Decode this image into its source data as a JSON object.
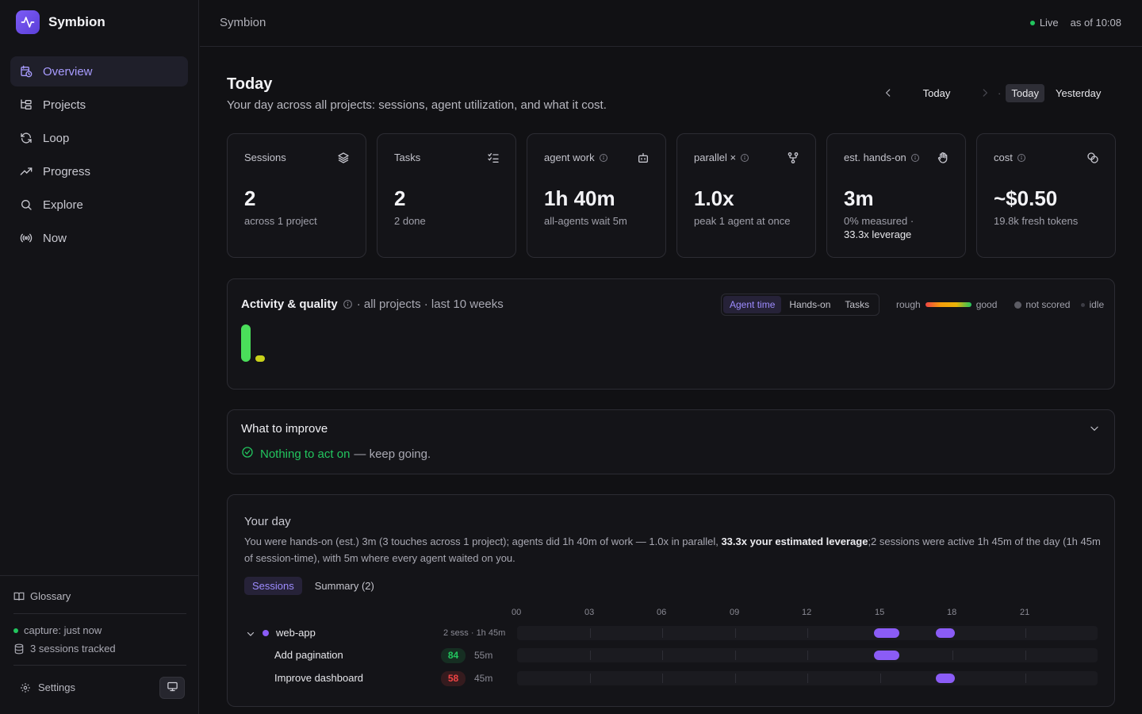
{
  "brand": {
    "name": "Symbion"
  },
  "sidebar": {
    "items": [
      {
        "label": "Overview",
        "icon": "calendar-clock-icon",
        "active": true
      },
      {
        "label": "Projects",
        "icon": "folder-tree-icon"
      },
      {
        "label": "Loop",
        "icon": "refresh-icon"
      },
      {
        "label": "Progress",
        "icon": "trend-up-icon"
      },
      {
        "label": "Explore",
        "icon": "search-icon"
      },
      {
        "label": "Now",
        "icon": "radio-broadcast-icon"
      }
    ],
    "glossary": "Glossary",
    "capture": "capture: just now",
    "tracked": "3 sessions tracked",
    "settings": "Settings"
  },
  "topbar": {
    "crumb": "Symbion",
    "live": "Live",
    "as_of": "as of 10:08"
  },
  "page": {
    "title": "Today",
    "subtitle": "Your day across all projects: sessions, agent utilization, and what it cost.",
    "date_current": "Today",
    "range_today": "Today",
    "range_yesterday": "Yesterday"
  },
  "stats": [
    {
      "label": "Sessions",
      "value": "2",
      "note": "across 1 project",
      "icon": "layers-icon"
    },
    {
      "label": "Tasks",
      "value": "2",
      "note": "2 done",
      "icon": "list-checks-icon"
    },
    {
      "label": "agent work",
      "value": "1h 40m",
      "note": "all-agents wait 5m",
      "icon": "bot-icon"
    },
    {
      "label": "parallel ×",
      "value": "1.0x",
      "note": "peak 1 agent at once",
      "icon": "git-fork-icon"
    },
    {
      "label": "est. hands-on",
      "value": "3m",
      "note": "0% measured ·",
      "note2": "33.3x leverage",
      "icon": "hand-icon"
    },
    {
      "label": "cost",
      "value": "~$0.50",
      "note": "19.8k fresh tokens",
      "icon": "coins-icon"
    }
  ],
  "activity": {
    "title": "Activity & quality",
    "scope": "· all projects · last 10 weeks",
    "modes": [
      "Agent time",
      "Hands-on",
      "Tasks"
    ],
    "active_mode": "Agent time",
    "legend": {
      "rough": "rough",
      "good": "good",
      "not_scored": "not scored",
      "idle": "idle"
    },
    "bars": [
      {
        "level": 1.0,
        "quality": "good",
        "color": "#4ade5a"
      },
      {
        "level": 0.17,
        "quality": "fair",
        "color": "#c9d21a"
      }
    ]
  },
  "improve": {
    "title": "What to improve",
    "ok_text": "Nothing to act on",
    "rest_text": "— keep going."
  },
  "day": {
    "title": "Your day",
    "desc_a": "You were hands-on (est.) 3m (3 touches across 1 project); agents did 1h 40m of work — 1.0x in parallel, ",
    "desc_b": "33.3x your estimated leverage",
    "desc_c": ";2 sessions were active 1h 45m of the day (1h 45m of session-time), with 5m where every agent waited on you.",
    "tabs": [
      "Sessions",
      "Summary (2)"
    ],
    "hours": [
      "00",
      "03",
      "06",
      "09",
      "12",
      "15",
      "18",
      "21"
    ],
    "project": {
      "name": "web-app",
      "meta": "2 sess · 1h 45m",
      "color": "#8b5cf6"
    },
    "sessions": [
      {
        "name": "Add pagination",
        "score": "84",
        "duration": "55m",
        "score_color": "#22c55e",
        "start_h": 14.75,
        "end_h": 15.8
      },
      {
        "name": "Improve dashboard",
        "score": "58",
        "duration": "45m",
        "score_color": "#ef4444",
        "start_h": 17.3,
        "end_h": 18.1
      }
    ]
  }
}
